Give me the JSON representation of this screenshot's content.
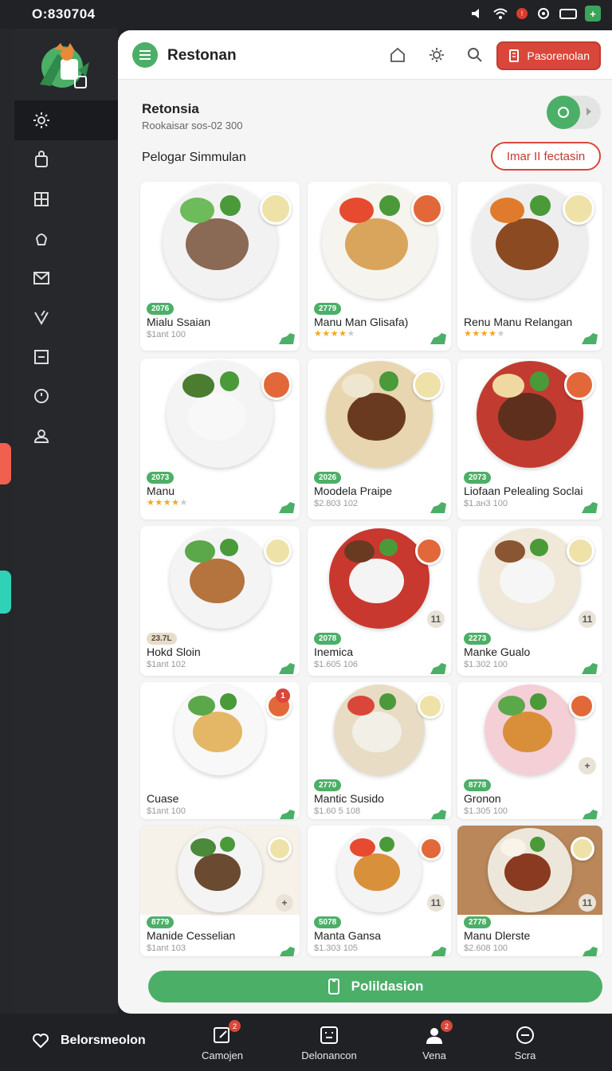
{
  "status_bar": {
    "time": "O:830704"
  },
  "header": {
    "app_title": "Restonan",
    "cta_label": "Pasorenolan"
  },
  "section": {
    "title": "Retonsia",
    "subtitle": "Rookaisar sos-02 300",
    "list_title": "Pelogar Simmulan",
    "filter_button": "Imar II fectasin"
  },
  "menu_items": [
    {
      "rating": "2076",
      "name": "Mialu Ssaian",
      "meta": "$1ant 100",
      "stars": null,
      "badge_style": "green"
    },
    {
      "rating": "2779",
      "name": "Manu Man Glisafa)",
      "meta": null,
      "stars": 4.5,
      "badge_style": "green"
    },
    {
      "rating": null,
      "name": "Renu Manu Relangan",
      "meta": null,
      "stars": 4.5,
      "badge_style": "green"
    },
    {
      "rating": "2073",
      "name": "Manu",
      "meta": null,
      "stars": 4.5,
      "badge_style": "green"
    },
    {
      "rating": "2026",
      "name": "Moodela Praipe",
      "meta": "$2.803 102",
      "stars": null,
      "badge_style": "green"
    },
    {
      "rating": "2073",
      "name": "Liofaan Pelealing Soclai",
      "meta": "$1.ан3 100",
      "stars": null,
      "badge_style": "green"
    },
    {
      "rating": "23.7L",
      "name": "Hokd Sloin",
      "meta": "$1ant 102",
      "stars": null,
      "badge_style": "beige"
    },
    {
      "rating": "2078",
      "name": "Inemica",
      "meta": "$1.605 106",
      "stars": null,
      "badge_style": "green",
      "chip": "11"
    },
    {
      "rating": "2273",
      "name": "Manke Gualo",
      "meta": "$1.302 100",
      "stars": null,
      "badge_style": "green",
      "chip": "11"
    },
    {
      "rating": null,
      "name": "Cuase",
      "meta": "$1ant 100",
      "stars": null,
      "badge_style": "green",
      "notif": "1"
    },
    {
      "rating": "2770",
      "name": "Mantic Susido",
      "meta": "$1.60 5 108",
      "stars": null,
      "badge_style": "green"
    },
    {
      "rating": "8778",
      "name": "Gronon",
      "meta": "$1.305 100",
      "stars": null,
      "badge_style": "green",
      "chip": "+"
    },
    {
      "rating": "8779",
      "name": "Manide Cesselian",
      "meta": "$1ant 103",
      "stars": null,
      "badge_style": "green",
      "chip": "+"
    },
    {
      "rating": "5078",
      "name": "Manta Gansa",
      "meta": "$1.303 105",
      "stars": null,
      "badge_style": "green",
      "chip": "11"
    },
    {
      "rating": "2778",
      "name": "Manu Dlerste",
      "meta": "$2.608 100",
      "stars": null,
      "badge_style": "green",
      "chip": "11"
    }
  ],
  "primary_button": "Polildasion",
  "bottom_nav": {
    "favorites_label": "Belorsmeolon",
    "items": [
      {
        "label": "Camojen",
        "badge": "2"
      },
      {
        "label": "Delonancon",
        "badge": null
      },
      {
        "label": "Vena",
        "badge": "2"
      },
      {
        "label": "Scra",
        "badge": null
      }
    ]
  },
  "colors": {
    "accent_green": "#4caf68",
    "accent_red": "#d9473a",
    "sidebar_bg": "#26282c",
    "panel_bg": "#f4f5f4"
  },
  "icons": {
    "sidebar": [
      "gear-icon",
      "bag-icon",
      "grid-icon",
      "cake-icon",
      "mail-icon",
      "heart-icon",
      "minus-box-icon",
      "clock-icon",
      "user-icon"
    ],
    "topbar": [
      "home-icon",
      "settings-icon",
      "search-icon",
      "receipt-icon"
    ]
  }
}
